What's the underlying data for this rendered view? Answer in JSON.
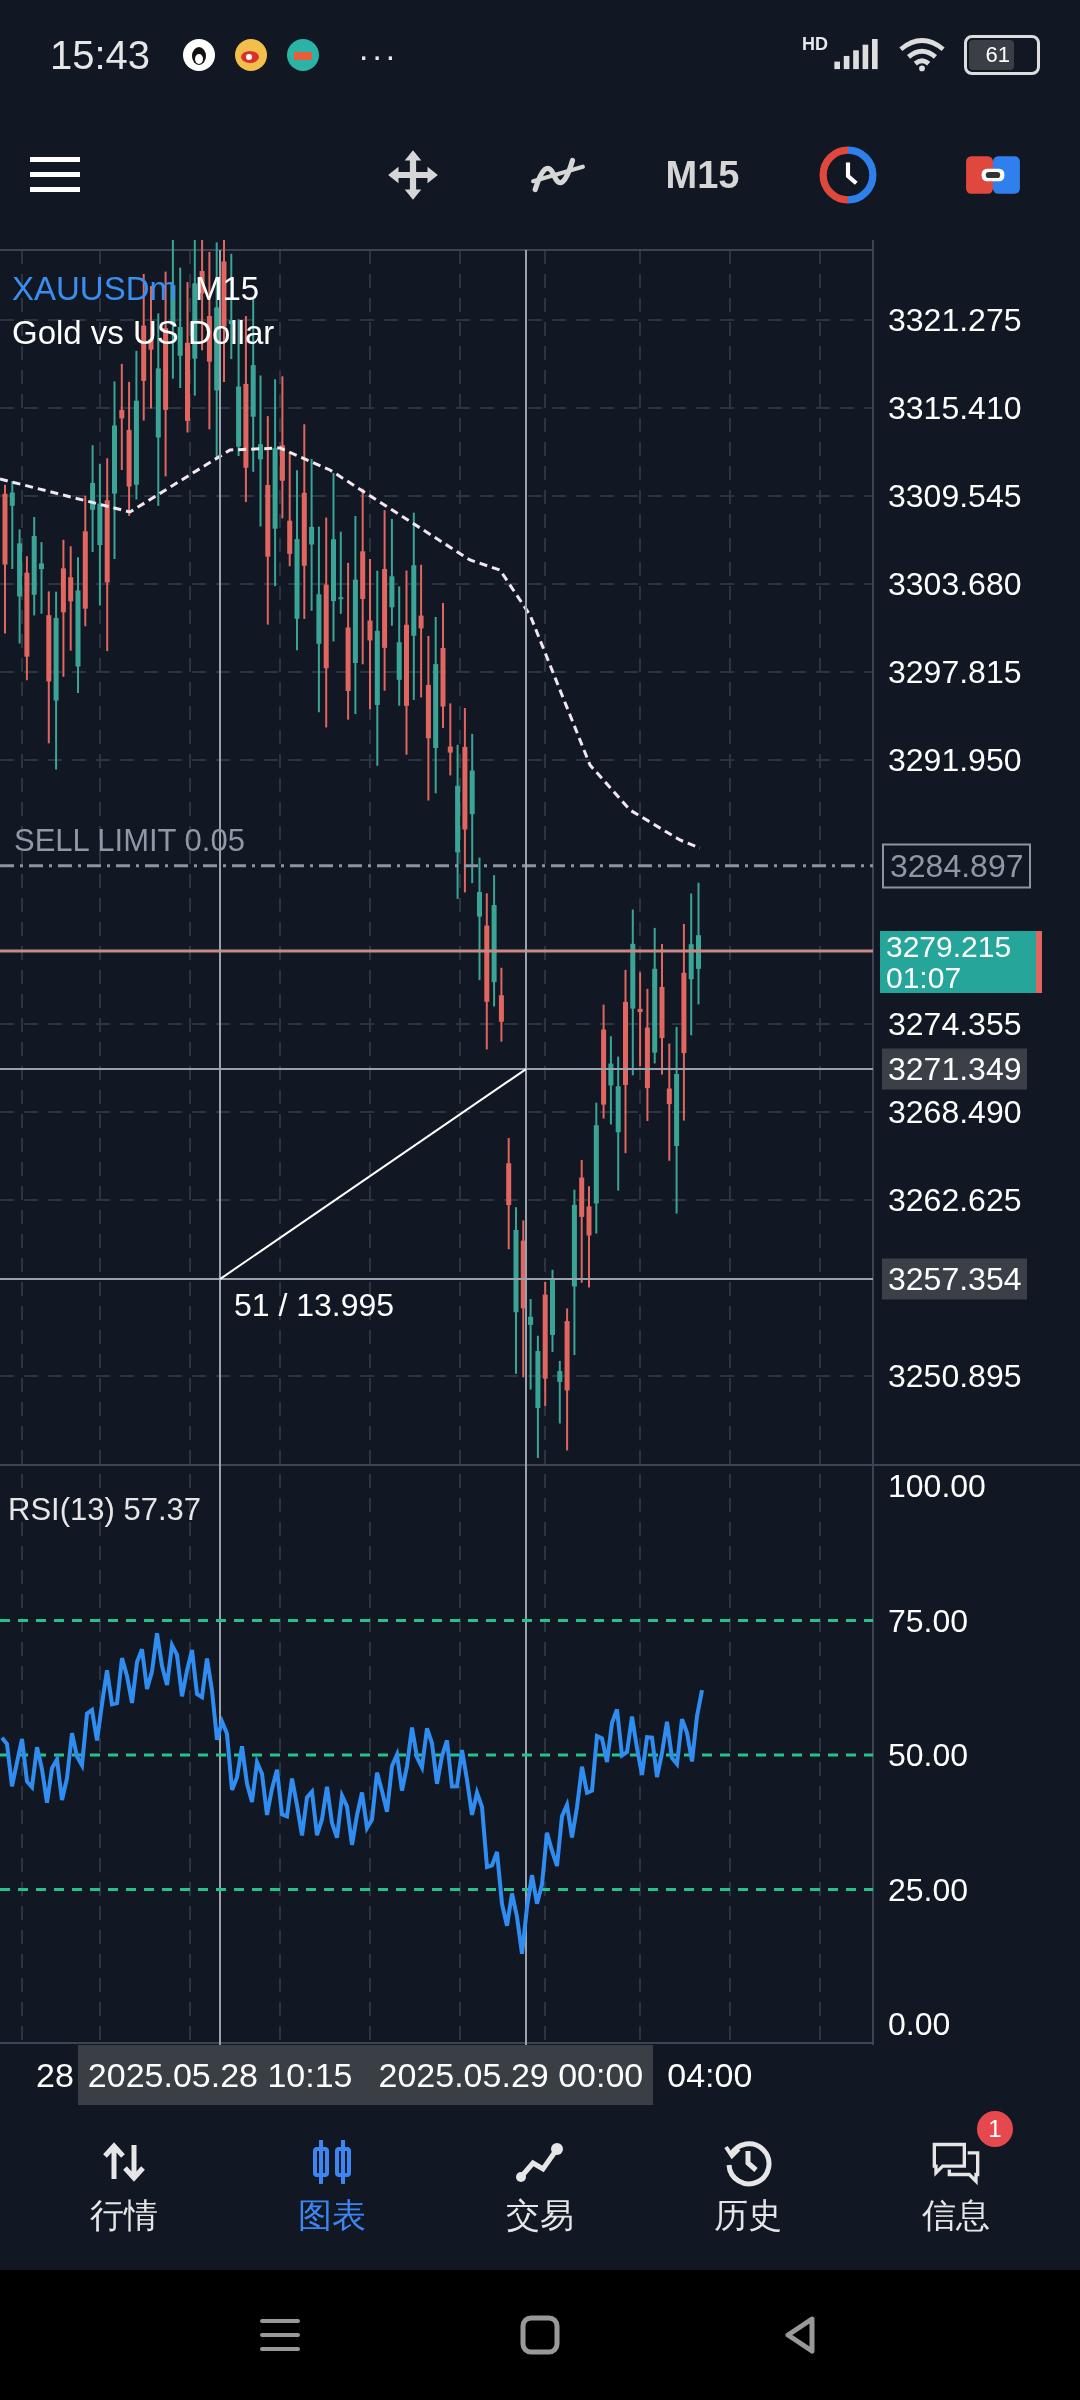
{
  "status_bar": {
    "time": "15:43",
    "more": "···",
    "network": "HD",
    "battery": "61"
  },
  "toolbar": {
    "timeframe": "M15"
  },
  "chart": {
    "symbol": "XAUUSDm",
    "timeframe": "M15",
    "description": "Gold vs US Dollar",
    "price_ticks": [
      "3321.275",
      "3315.410",
      "3309.545",
      "3303.680",
      "3297.815",
      "3291.950",
      "3274.355",
      "3268.490",
      "3262.625",
      "3250.895"
    ],
    "order": {
      "label": "SELL LIMIT 0.05",
      "price": "3284.897"
    },
    "bid": {
      "price": "3279.215",
      "countdown": "01:07"
    },
    "crosshair": {
      "price": "3271.349",
      "start_price": "3257.354",
      "measure": "51 / 13.995"
    }
  },
  "rsi": {
    "label": "RSI(13) 57.37",
    "ticks": [
      "100.00",
      "75.00",
      "50.00",
      "25.00",
      "0.00"
    ]
  },
  "time_axis": {
    "cut_label": "28",
    "crosshair_start": "2025.05.28 10:15",
    "crosshair_end": "2025.05.29 00:00",
    "label": "04:00"
  },
  "nav": [
    {
      "kind": "quotes",
      "label": "行情",
      "selected": false
    },
    {
      "kind": "chart",
      "label": "图表",
      "selected": true
    },
    {
      "kind": "trade",
      "label": "交易",
      "selected": false
    },
    {
      "kind": "history",
      "label": "历史",
      "selected": false
    },
    {
      "kind": "messages",
      "label": "信息",
      "selected": false,
      "badge": "1"
    }
  ]
}
